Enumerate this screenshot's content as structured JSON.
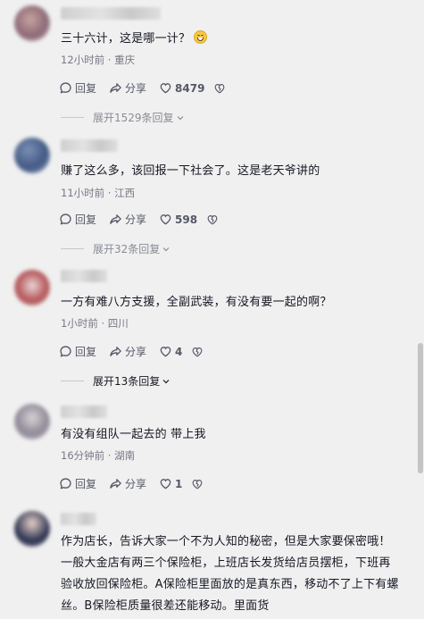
{
  "actions": {
    "reply_label": "回复",
    "share_label": "分享"
  },
  "comments": [
    {
      "text": "三十六计，这是哪一计？",
      "emoji": "grinning-emoji",
      "time": "12小时前",
      "location": "重庆",
      "likes": "8479",
      "expand": "展开1529条回复"
    },
    {
      "text": "赚了这么多，该回报一下社会了。这是老天爷讲的",
      "time": "11小时前",
      "location": "江西",
      "likes": "598",
      "expand": "展开32条回复"
    },
    {
      "text": "一方有难八方支援，全副武装，有没有要一起的啊？",
      "time": "1小时前",
      "location": "四川",
      "likes": "4",
      "expand": "展开13条回复"
    },
    {
      "text": "有没有组队一起去的 带上我",
      "time": "16分钟前",
      "location": "湖南",
      "likes": "1"
    },
    {
      "text": "作为店长，告诉大家一个不为人知的秘密，但是大家要保密哦！一般大金店有两三个保险柜，上班店长发货给店员摆柜，下班再验收放回保险柜。A保险柜里面放的是真东西，移动不了上下有螺丝。B保险柜质量很差还能移动。里面货"
    }
  ],
  "colors": {
    "background": "#f0f0f0",
    "text": "#161823",
    "meta": "#777985"
  }
}
